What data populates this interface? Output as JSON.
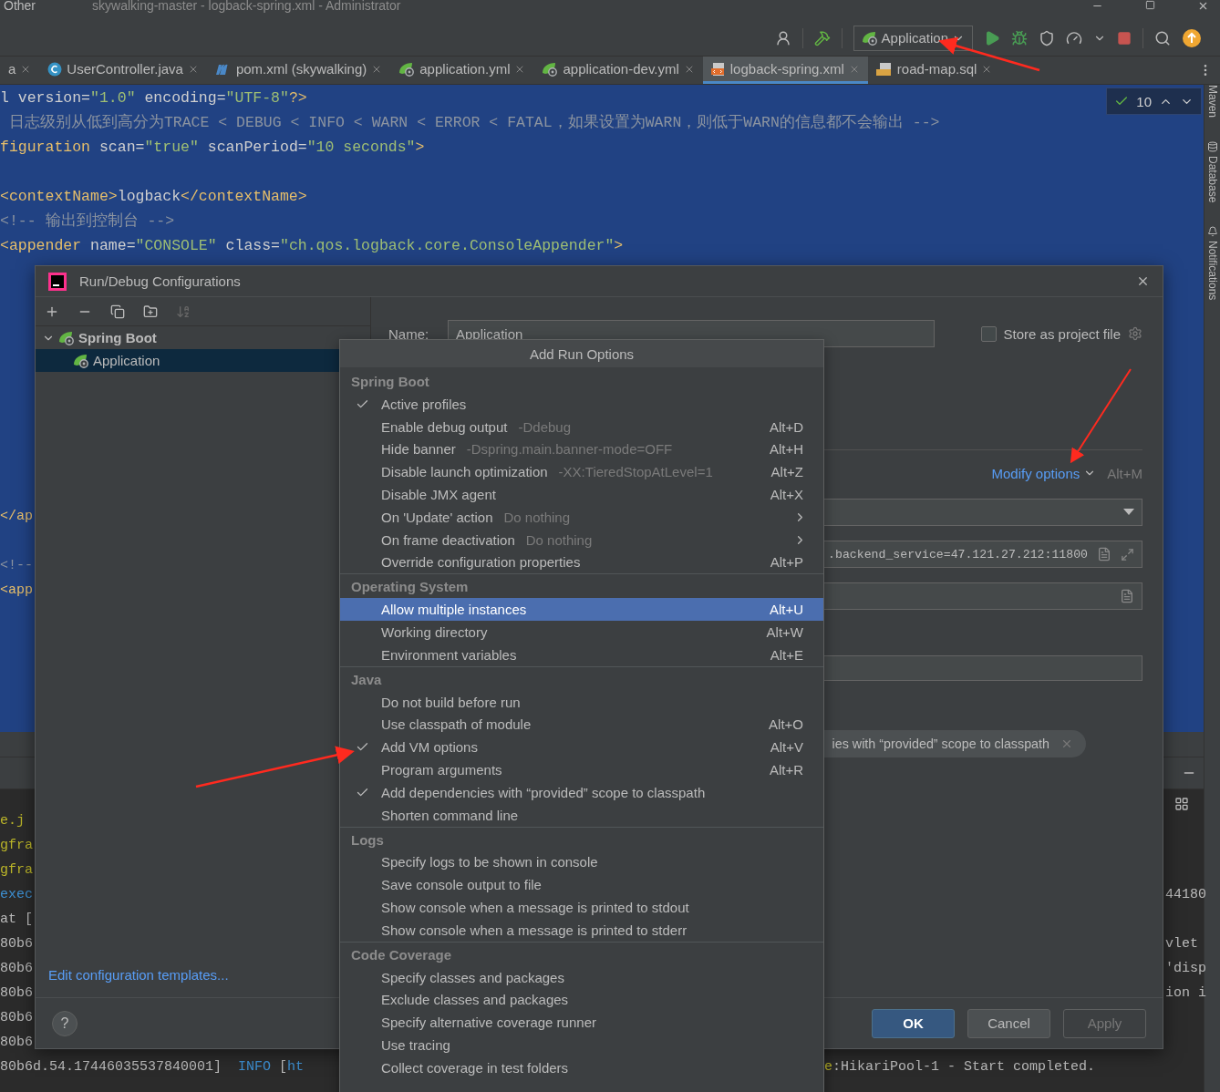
{
  "title_bar": {
    "menu": "Other",
    "title": "skywalking-master - logback-spring.xml - Administrator"
  },
  "toolbar": {
    "run_config": "Application"
  },
  "tabs": [
    {
      "label": "a",
      "kind": "none",
      "selected": false
    },
    {
      "label": "UserController.java",
      "kind": "class",
      "selected": false
    },
    {
      "label": "pom.xml (skywalking)",
      "kind": "maven",
      "selected": false
    },
    {
      "label": "application.yml",
      "kind": "spring",
      "selected": false
    },
    {
      "label": "application-dev.yml",
      "kind": "spring",
      "selected": false
    },
    {
      "label": "logback-spring.xml",
      "kind": "xml",
      "selected": true
    },
    {
      "label": "road-map.sql",
      "kind": "sql",
      "selected": false
    }
  ],
  "side_strip": [
    "Maven",
    "Database",
    "Notifications"
  ],
  "editor": {
    "inspections": "10",
    "top_groups": [
      [
        {
          "segments": [
            {
              "text": "l version=",
              "kind": "attr"
            },
            {
              "text": "\"1.0\"",
              "kind": "string"
            },
            {
              "text": " encoding=",
              "kind": "attr"
            },
            {
              "text": "\"UTF-8\"",
              "kind": "string"
            },
            {
              "text": "?>",
              "kind": "tag"
            }
          ]
        },
        {
          "segments": [
            {
              "text": " 日志级别从低到高分为TRACE < DEBUG < INFO < WARN < ERROR < FATAL，如果设置为WARN，则低于WARN的信息都不会输出 -->",
              "kind": "comment"
            }
          ]
        },
        {
          "segments": [
            {
              "text": "figuration",
              "kind": "tag"
            },
            {
              "text": " scan=",
              "kind": "attr"
            },
            {
              "text": "\"true\"",
              "kind": "string"
            },
            {
              "text": " scanPeriod=",
              "kind": "attr"
            },
            {
              "text": "\"10 seconds\"",
              "kind": "string"
            },
            {
              "text": ">",
              "kind": "tag"
            }
          ]
        }
      ],
      [
        {
          "segments": [
            {
              "text": "<contextName>",
              "kind": "tag"
            },
            {
              "text": "logback",
              "kind": "text"
            },
            {
              "text": "</contextName>",
              "kind": "tag"
            }
          ]
        },
        {
          "segments": [
            {
              "text": "<!-- 输出到控制台 -->",
              "kind": "comment"
            }
          ]
        },
        {
          "segments": [
            {
              "text": "<appender",
              "kind": "tag"
            },
            {
              "text": " name=",
              "kind": "attr"
            },
            {
              "text": "\"CONSOLE\"",
              "kind": "string"
            },
            {
              "text": " class=",
              "kind": "attr"
            },
            {
              "text": "\"ch.qos.logback.core.ConsoleAppender\"",
              "kind": "string"
            },
            {
              "text": ">",
              "kind": "tag"
            }
          ]
        }
      ]
    ],
    "lower_groups": [
      [
        {
          "segments": [
            {
              "text": "</ap",
              "kind": "tag"
            }
          ]
        }
      ],
      [
        {
          "segments": [
            {
              "text": "<!--",
              "kind": "comment"
            }
          ]
        },
        {
          "segments": [
            {
              "text": "<app",
              "kind": "tag"
            }
          ]
        }
      ]
    ]
  },
  "console": {
    "rows": [
      {
        "kind": "gutter",
        "left": [
          {
            "text": "e.j",
            "kind": "path"
          }
        ]
      },
      {
        "kind": "gutter",
        "left": [
          {
            "text": "gfra",
            "kind": "path"
          }
        ]
      },
      {
        "kind": "gutter",
        "left": [
          {
            "text": "gfra",
            "kind": "path"
          }
        ]
      },
      {
        "kind": "gutter",
        "left": [
          {
            "text": "exec",
            "kind": "thread"
          }
        ],
        "right": [
          {
            "text": "44180",
            "kind": "plain"
          }
        ]
      },
      {
        "kind": "gutter",
        "left": [
          {
            "text": "at [",
            "kind": "plain"
          }
        ]
      },
      {
        "kind": "gutter",
        "left": [
          {
            "text": "80b6",
            "kind": "plain"
          }
        ],
        "right": [
          {
            "text": "vlet",
            "kind": "plain"
          }
        ]
      },
      {
        "kind": "gutter",
        "left": [
          {
            "text": "80b6",
            "kind": "plain"
          }
        ],
        "right": [
          {
            "text": "'disp",
            "kind": "plain"
          }
        ]
      },
      {
        "kind": "gutter",
        "left": [
          {
            "text": "80b6",
            "kind": "plain"
          }
        ],
        "right": [
          {
            "text": "ion i",
            "kind": "plain"
          }
        ]
      },
      {
        "kind": "gutter",
        "left": [
          {
            "text": "80b6",
            "kind": "plain"
          }
        ]
      },
      {
        "kind": "gutter",
        "left": [
          {
            "text": "80b6",
            "kind": "plain"
          }
        ]
      },
      {
        "kind": "wide",
        "left": [
          {
            "text": "80b6d.54.17446035537840001]  ",
            "kind": "plain"
          },
          {
            "text": "INFO",
            "kind": "thread"
          },
          {
            "text": " [",
            "kind": "plain"
          },
          {
            "text": "ht",
            "kind": "thread"
          }
        ],
        "right": [
          {
            "text": "e",
            "kind": "path"
          },
          {
            "text": ":HikariPool-1 - Start completed.",
            "kind": "plain"
          }
        ]
      }
    ]
  },
  "dialog": {
    "title": "Run/Debug Configurations",
    "tree": [
      {
        "label": "Spring Boot",
        "expanded": true,
        "selected": false,
        "children": [
          {
            "label": "Application",
            "selected": true
          }
        ]
      }
    ],
    "templates_link": "Edit configuration templates...",
    "help": "?",
    "name_label": "Name:",
    "name_value": "Application",
    "store_checkbox": {
      "label": "Store as project file",
      "checked": false
    },
    "modify_options": {
      "label": "Modify options",
      "shortcut": "Alt+M"
    },
    "vm_options_value": ".backend_service=47.121.27.212:11800",
    "chip": "ies with “provided” scope to classpath",
    "buttons": [
      {
        "label": "OK",
        "kind": "primary"
      },
      {
        "label": "Cancel",
        "kind": "normal"
      },
      {
        "label": "Apply",
        "kind": "disabled"
      }
    ]
  },
  "popup": {
    "title": "Add Run Options",
    "sections": [
      {
        "heading": "Spring Boot",
        "items": [
          {
            "label": "Active profiles",
            "checked": true,
            "selected": false,
            "submenu": false
          },
          {
            "label": "Enable debug output",
            "hint": "-Ddebug",
            "shortcut": "Alt+D",
            "checked": false,
            "selected": false,
            "submenu": false
          },
          {
            "label": "Hide banner",
            "hint": "-Dspring.main.banner-mode=OFF",
            "shortcut": "Alt+H",
            "checked": false,
            "selected": false,
            "submenu": false
          },
          {
            "label": "Disable launch optimization",
            "hint": "-XX:TieredStopAtLevel=1",
            "shortcut": "Alt+Z",
            "checked": false,
            "selected": false,
            "submenu": false
          },
          {
            "label": "Disable JMX agent",
            "shortcut": "Alt+X",
            "checked": false,
            "selected": false,
            "submenu": false
          },
          {
            "label": "On 'Update' action",
            "hint": "Do nothing",
            "checked": false,
            "selected": false,
            "submenu": true
          },
          {
            "label": "On frame deactivation",
            "hint": "Do nothing",
            "checked": false,
            "selected": false,
            "submenu": true
          },
          {
            "label": "Override configuration properties",
            "shortcut": "Alt+P",
            "checked": false,
            "selected": false,
            "submenu": false
          }
        ]
      },
      {
        "heading": "Operating System",
        "items": [
          {
            "label": "Allow multiple instances",
            "shortcut": "Alt+U",
            "checked": false,
            "selected": true,
            "submenu": false
          },
          {
            "label": "Working directory",
            "shortcut": "Alt+W",
            "checked": false,
            "selected": false,
            "submenu": false
          },
          {
            "label": "Environment variables",
            "shortcut": "Alt+E",
            "checked": false,
            "selected": false,
            "submenu": false
          }
        ]
      },
      {
        "heading": "Java",
        "items": [
          {
            "label": "Do not build before run",
            "checked": false,
            "selected": false,
            "submenu": false
          },
          {
            "label": "Use classpath of module",
            "shortcut": "Alt+O",
            "checked": false,
            "selected": false,
            "submenu": false
          },
          {
            "label": "Add VM options",
            "shortcut": "Alt+V",
            "checked": true,
            "selected": false,
            "submenu": false
          },
          {
            "label": "Program arguments",
            "shortcut": "Alt+R",
            "checked": false,
            "selected": false,
            "submenu": false
          },
          {
            "label": "Add dependencies with “provided” scope to classpath",
            "checked": true,
            "selected": false,
            "submenu": false
          },
          {
            "label": "Shorten command line",
            "checked": false,
            "selected": false,
            "submenu": false
          }
        ]
      },
      {
        "heading": "Logs",
        "items": [
          {
            "label": "Specify logs to be shown in console",
            "checked": false,
            "selected": false,
            "submenu": false
          },
          {
            "label": "Save console output to file",
            "checked": false,
            "selected": false,
            "submenu": false
          },
          {
            "label": "Show console when a message is printed to stdout",
            "checked": false,
            "selected": false,
            "submenu": false
          },
          {
            "label": "Show console when a message is printed to stderr",
            "checked": false,
            "selected": false,
            "submenu": false
          }
        ]
      },
      {
        "heading": "Code Coverage",
        "items": [
          {
            "label": "Specify classes and packages",
            "checked": false,
            "selected": false,
            "submenu": false
          },
          {
            "label": "Exclude classes and packages",
            "checked": false,
            "selected": false,
            "submenu": false
          },
          {
            "label": "Specify alternative coverage runner",
            "checked": false,
            "selected": false,
            "submenu": false
          },
          {
            "label": "Use tracing",
            "checked": false,
            "selected": false,
            "submenu": false
          },
          {
            "label": "Collect coverage in test folders",
            "checked": false,
            "selected": false,
            "submenu": false
          }
        ]
      }
    ]
  }
}
